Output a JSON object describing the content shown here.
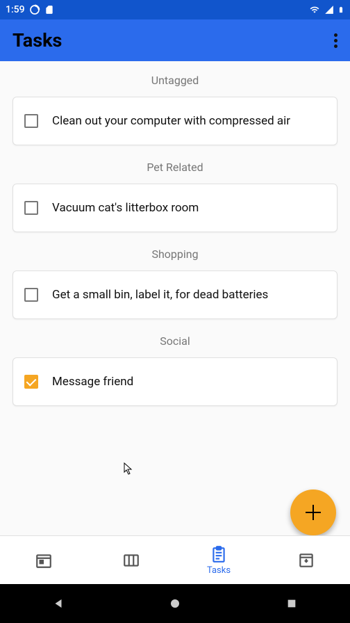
{
  "status": {
    "time": "1:59"
  },
  "appbar": {
    "title": "Tasks"
  },
  "sections": [
    {
      "header": "Untagged",
      "task": {
        "label": "Clean out your computer with compressed air",
        "checked": false
      }
    },
    {
      "header": "Pet Related",
      "task": {
        "label": "Vacuum cat's litterbox room",
        "checked": false
      }
    },
    {
      "header": "Shopping",
      "task": {
        "label": "Get a small bin, label it, for dead batteries",
        "checked": false
      }
    },
    {
      "header": "Social",
      "task": {
        "label": "Message friend",
        "checked": true
      }
    }
  ],
  "bottomnav": {
    "tasks_label": "Tasks"
  }
}
